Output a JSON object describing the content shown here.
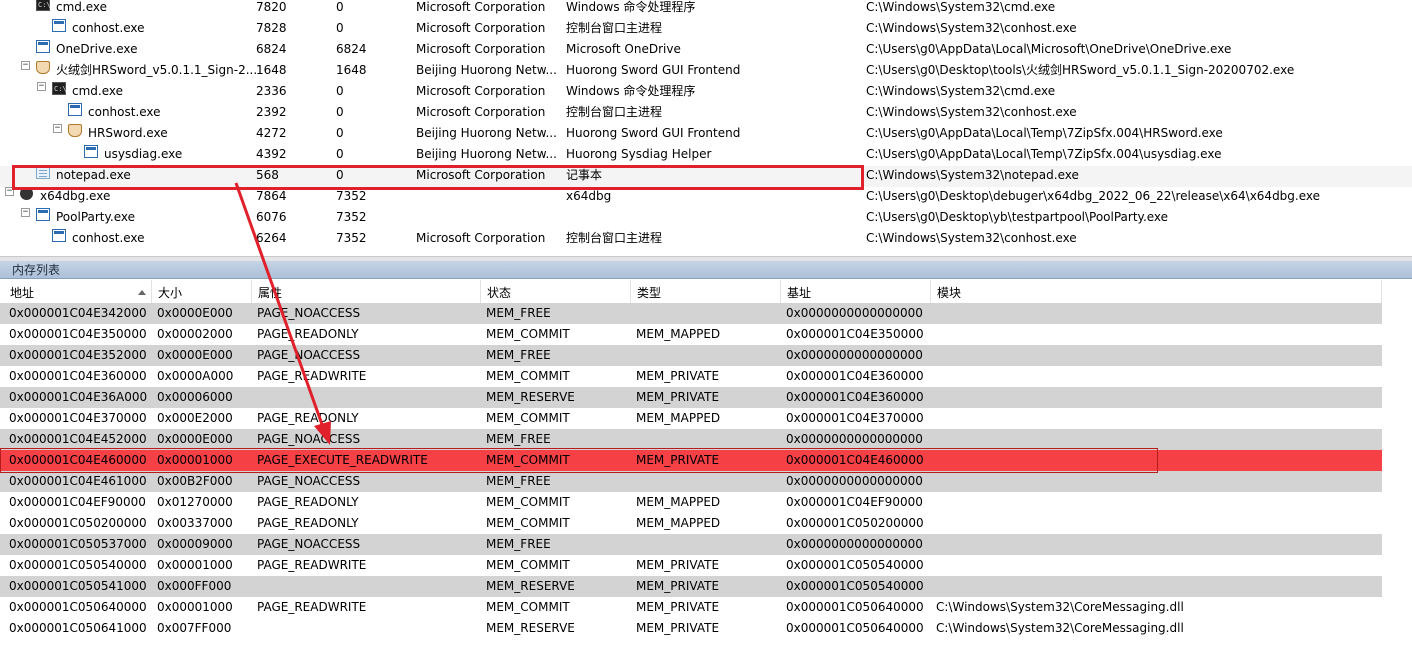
{
  "processes": [
    {
      "name": "cmd.exe",
      "pid": "7820",
      "ppid": "0",
      "company": "Microsoft Corporation",
      "desc": "Windows 命令处理程序",
      "path": "C:\\Windows\\System32\\cmd.exe",
      "icon": "console-icon"
    },
    {
      "name": "conhost.exe",
      "pid": "7828",
      "ppid": "0",
      "company": "Microsoft Corporation",
      "desc": "控制台窗口主进程",
      "path": "C:\\Windows\\System32\\conhost.exe",
      "icon": "window-icon"
    },
    {
      "name": "OneDrive.exe",
      "pid": "6824",
      "ppid": "6824",
      "company": "Microsoft Corporation",
      "desc": "Microsoft OneDrive",
      "path": "C:\\Users\\g0\\AppData\\Local\\Microsoft\\OneDrive\\OneDrive.exe",
      "icon": "window-icon"
    },
    {
      "name": "火绒剑HRSword_v5.0.1.1_Sign-2...",
      "pid": "1648",
      "ppid": "1648",
      "company": "Beijing Huorong Netw...",
      "desc": "Huorong Sword GUI Frontend",
      "path": "C:\\Users\\g0\\Desktop\\tools\\火绒剑HRSword_v5.0.1.1_Sign-20200702.exe",
      "icon": "shield-icon"
    },
    {
      "name": "cmd.exe",
      "pid": "2336",
      "ppid": "0",
      "company": "Microsoft Corporation",
      "desc": "Windows 命令处理程序",
      "path": "C:\\Windows\\System32\\cmd.exe",
      "icon": "console-icon"
    },
    {
      "name": "conhost.exe",
      "pid": "2392",
      "ppid": "0",
      "company": "Microsoft Corporation",
      "desc": "控制台窗口主进程",
      "path": "C:\\Windows\\System32\\conhost.exe",
      "icon": "window-icon"
    },
    {
      "name": "HRSword.exe",
      "pid": "4272",
      "ppid": "0",
      "company": "Beijing Huorong Netw...",
      "desc": "Huorong Sword GUI Frontend",
      "path": "C:\\Users\\g0\\AppData\\Local\\Temp\\7ZipSfx.004\\HRSword.exe",
      "icon": "shield-icon"
    },
    {
      "name": "usysdiag.exe",
      "pid": "4392",
      "ppid": "0",
      "company": "Beijing Huorong Netw...",
      "desc": "Huorong Sysdiag Helper",
      "path": "C:\\Users\\g0\\AppData\\Local\\Temp\\7ZipSfx.004\\usysdiag.exe",
      "icon": "window-icon"
    },
    {
      "name": "notepad.exe",
      "pid": "568",
      "ppid": "0",
      "company": "Microsoft Corporation",
      "desc": "记事本",
      "path": "C:\\Windows\\System32\\notepad.exe",
      "icon": "notepad-icon"
    },
    {
      "name": "x64dbg.exe",
      "pid": "7864",
      "ppid": "7352",
      "company": "",
      "desc": "x64dbg",
      "path": "C:\\Users\\g0\\Desktop\\debuger\\x64dbg_2022_06_22\\release\\x64\\x64dbg.exe",
      "icon": "bug-icon"
    },
    {
      "name": "PoolParty.exe",
      "pid": "6076",
      "ppid": "7352",
      "company": "",
      "desc": "",
      "path": "C:\\Users\\g0\\Desktop\\yb\\testpartpool\\PoolParty.exe",
      "icon": "window-icon"
    },
    {
      "name": "conhost.exe",
      "pid": "6264",
      "ppid": "7352",
      "company": "Microsoft Corporation",
      "desc": "控制台窗口主进程",
      "path": "C:\\Windows\\System32\\conhost.exe",
      "icon": "window-icon"
    }
  ],
  "memory_panel": {
    "title": "内存列表",
    "columns": [
      "地址",
      "大小",
      "属性",
      "状态",
      "类型",
      "基址",
      "模块"
    ],
    "rows": [
      {
        "addr": "0x000001C04E342000",
        "size": "0x0000E000",
        "prot": "PAGE_NOACCESS",
        "state": "MEM_FREE",
        "type": "",
        "base": "0x0000000000000000",
        "module": ""
      },
      {
        "addr": "0x000001C04E350000",
        "size": "0x00002000",
        "prot": "PAGE_READONLY",
        "state": "MEM_COMMIT",
        "type": "MEM_MAPPED",
        "base": "0x000001C04E350000",
        "module": ""
      },
      {
        "addr": "0x000001C04E352000",
        "size": "0x0000E000",
        "prot": "PAGE_NOACCESS",
        "state": "MEM_FREE",
        "type": "",
        "base": "0x0000000000000000",
        "module": ""
      },
      {
        "addr": "0x000001C04E360000",
        "size": "0x0000A000",
        "prot": "PAGE_READWRITE",
        "state": "MEM_COMMIT",
        "type": "MEM_PRIVATE",
        "base": "0x000001C04E360000",
        "module": ""
      },
      {
        "addr": "0x000001C04E36A000",
        "size": "0x00006000",
        "prot": "",
        "state": "MEM_RESERVE",
        "type": "MEM_PRIVATE",
        "base": "0x000001C04E360000",
        "module": ""
      },
      {
        "addr": "0x000001C04E370000",
        "size": "0x000E2000",
        "prot": "PAGE_READONLY",
        "state": "MEM_COMMIT",
        "type": "MEM_MAPPED",
        "base": "0x000001C04E370000",
        "module": ""
      },
      {
        "addr": "0x000001C04E452000",
        "size": "0x0000E000",
        "prot": "PAGE_NOACCESS",
        "state": "MEM_FREE",
        "type": "",
        "base": "0x0000000000000000",
        "module": ""
      },
      {
        "addr": "0x000001C04E460000",
        "size": "0x00001000",
        "prot": "PAGE_EXECUTE_READWRITE",
        "state": "MEM_COMMIT",
        "type": "MEM_PRIVATE",
        "base": "0x000001C04E460000",
        "module": ""
      },
      {
        "addr": "0x000001C04E461000",
        "size": "0x00B2F000",
        "prot": "PAGE_NOACCESS",
        "state": "MEM_FREE",
        "type": "",
        "base": "0x0000000000000000",
        "module": ""
      },
      {
        "addr": "0x000001C04EF90000",
        "size": "0x01270000",
        "prot": "PAGE_READONLY",
        "state": "MEM_COMMIT",
        "type": "MEM_MAPPED",
        "base": "0x000001C04EF90000",
        "module": ""
      },
      {
        "addr": "0x000001C050200000",
        "size": "0x00337000",
        "prot": "PAGE_READONLY",
        "state": "MEM_COMMIT",
        "type": "MEM_MAPPED",
        "base": "0x000001C050200000",
        "module": ""
      },
      {
        "addr": "0x000001C050537000",
        "size": "0x00009000",
        "prot": "PAGE_NOACCESS",
        "state": "MEM_FREE",
        "type": "",
        "base": "0x0000000000000000",
        "module": ""
      },
      {
        "addr": "0x000001C050540000",
        "size": "0x00001000",
        "prot": "PAGE_READWRITE",
        "state": "MEM_COMMIT",
        "type": "MEM_PRIVATE",
        "base": "0x000001C050540000",
        "module": ""
      },
      {
        "addr": "0x000001C050541000",
        "size": "0x000FF000",
        "prot": "",
        "state": "MEM_RESERVE",
        "type": "MEM_PRIVATE",
        "base": "0x000001C050540000",
        "module": ""
      },
      {
        "addr": "0x000001C050640000",
        "size": "0x00001000",
        "prot": "PAGE_READWRITE",
        "state": "MEM_COMMIT",
        "type": "MEM_PRIVATE",
        "base": "0x000001C050640000",
        "module": "C:\\Windows\\System32\\CoreMessaging.dll"
      },
      {
        "addr": "0x000001C050641000",
        "size": "0x007FF000",
        "prot": "",
        "state": "MEM_RESERVE",
        "type": "MEM_PRIVATE",
        "base": "0x000001C050640000",
        "module": "C:\\Windows\\System32\\CoreMessaging.dll"
      }
    ]
  },
  "colors": {
    "highlight_red": "#f54045",
    "annotation_red": "#e0202a",
    "row_gray": "#d3d3d3",
    "panel_header": "#b9cade"
  }
}
